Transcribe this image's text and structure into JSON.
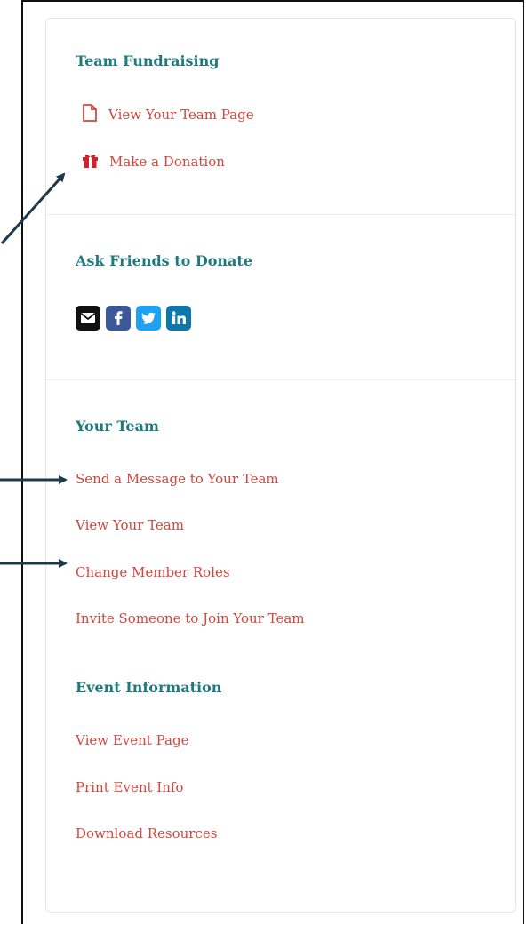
{
  "sections": {
    "team_fundraising": {
      "heading": "Team Fundraising",
      "links": [
        "View Your Team Page",
        "Make a Donation"
      ]
    },
    "ask_friends": {
      "heading": "Ask Friends to Donate",
      "share_icons": [
        "email-icon",
        "facebook-icon",
        "twitter-icon",
        "linkedin-icon"
      ]
    },
    "your_team": {
      "heading": "Your Team",
      "links": [
        "Send a Message to Your Team",
        "View Your Team",
        "Change Member Roles",
        "Invite Someone to Join Your Team"
      ]
    },
    "event_information": {
      "heading": "Event Information",
      "links": [
        "View Event Page",
        "Print Event Info",
        "Download Resources"
      ]
    }
  },
  "colors": {
    "heading": "#1f7a80",
    "link": "#d2463c",
    "arrow": "#1d3a4a",
    "email_bg": "#111111",
    "facebook_bg": "#3b5998",
    "twitter_bg": "#1da1f2",
    "linkedin_bg": "#0e76a8"
  }
}
